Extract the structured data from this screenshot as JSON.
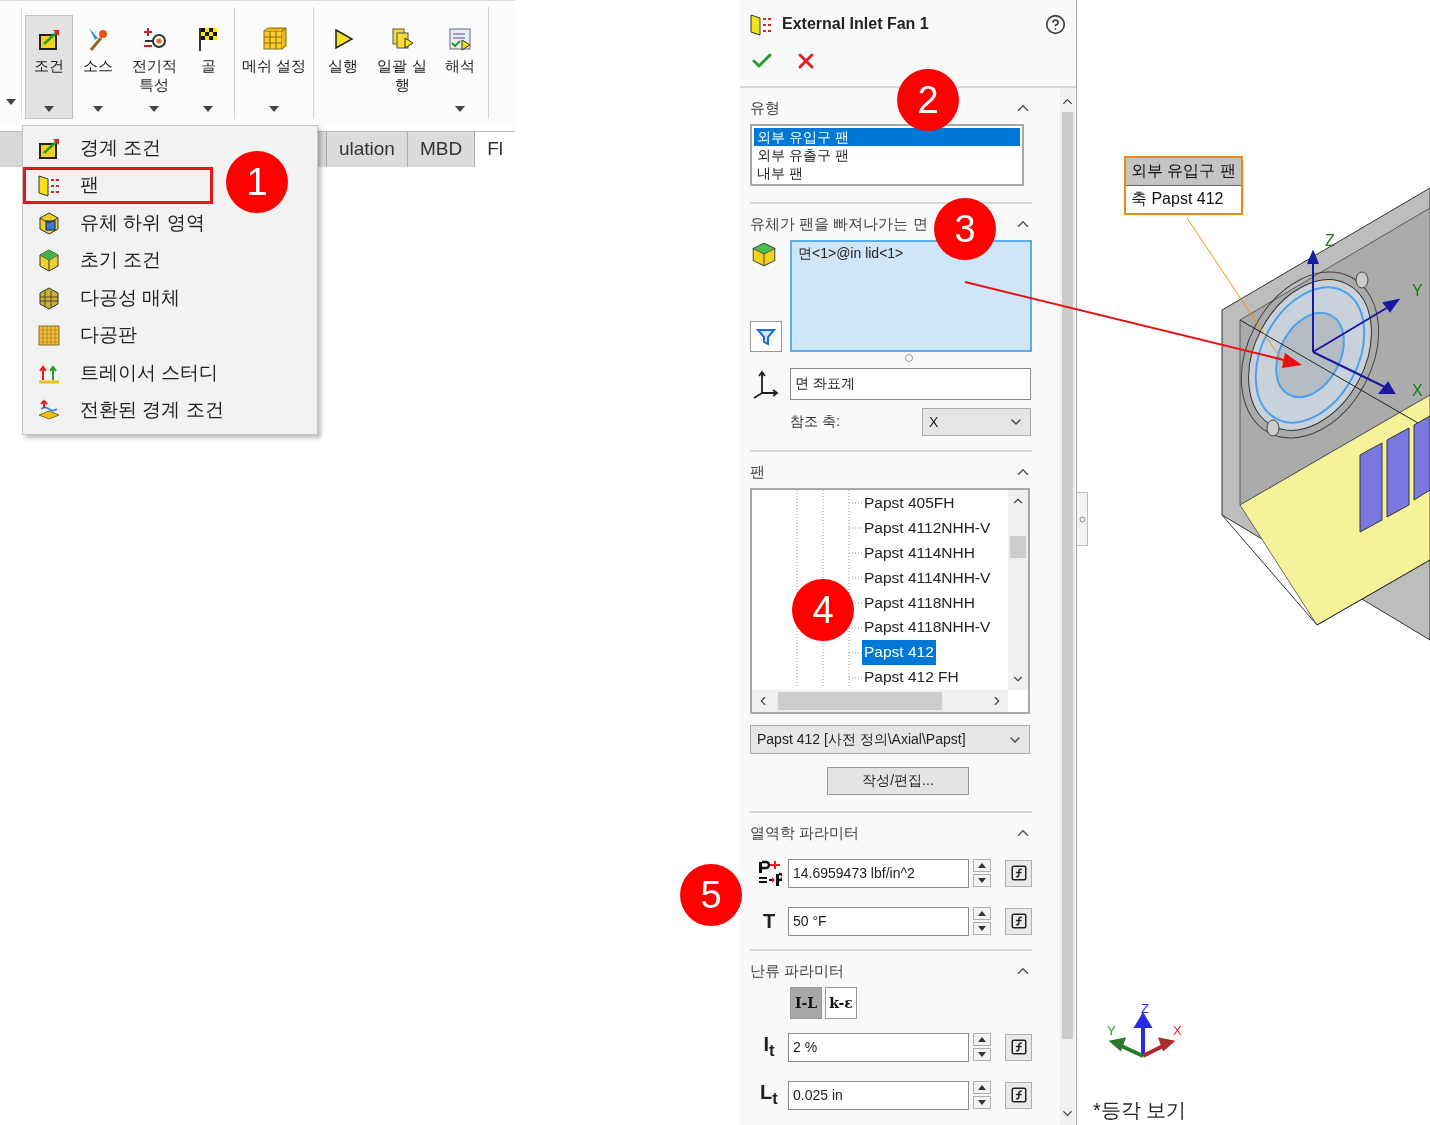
{
  "ribbon": {
    "groups": [
      {
        "buttons": [
          {
            "label": "조건",
            "selected": true,
            "dropdown": true
          },
          {
            "label": "소스",
            "selected": false,
            "dropdown": true
          },
          {
            "label": "전기적 특성",
            "selected": false,
            "dropdown": true
          },
          {
            "label": "골",
            "selected": false,
            "dropdown": true
          }
        ]
      },
      {
        "buttons": [
          {
            "label": "메쉬 설정",
            "selected": false,
            "dropdown": true
          }
        ]
      },
      {
        "buttons": [
          {
            "label": "실행",
            "selected": false,
            "dropdown": false
          },
          {
            "label": "일괄 실행",
            "selected": false,
            "dropdown": false
          },
          {
            "label": "해석",
            "selected": false,
            "dropdown": true
          }
        ]
      }
    ],
    "tabs": [
      {
        "label": "ulation",
        "selected": false
      },
      {
        "label": "MBD",
        "selected": false
      },
      {
        "label": "Fl",
        "selected": true
      }
    ]
  },
  "menu": {
    "items": [
      {
        "label": "경계 조건",
        "highlighted": false
      },
      {
        "label": "팬",
        "highlighted": true
      },
      {
        "label": "유체 하위 영역",
        "highlighted": false
      },
      {
        "label": "초기 조건",
        "highlighted": false
      },
      {
        "label": "다공성 매체",
        "highlighted": false
      },
      {
        "label": "다공판",
        "highlighted": false
      },
      {
        "label": "트레이서 스터디",
        "highlighted": false
      },
      {
        "label": "전환된 경계 조건",
        "highlighted": false
      }
    ]
  },
  "panel": {
    "title": "External Inlet Fan 1",
    "sections": [
      {
        "kind": "list",
        "title": "유형",
        "expanded": true,
        "items": [
          {
            "label": "외부 유입구 팬",
            "selected": true
          },
          {
            "label": "외부 유출구 팬",
            "selected": false
          },
          {
            "label": "내부 팬",
            "selected": false
          }
        ]
      },
      {
        "kind": "face",
        "title": "유체가 팬을 빠져나가는 면",
        "expanded": true,
        "faces": [
          "면<1>@in lid<1>"
        ],
        "coordinate_system": "면 좌표계",
        "reference_axis_label": "참조 축:",
        "reference_axis": "X"
      },
      {
        "kind": "fan",
        "title": "팬",
        "expanded": true,
        "tree": [
          {
            "label": "Papst 405FH",
            "selected": false
          },
          {
            "label": "Papst 4112NHH-V",
            "selected": false
          },
          {
            "label": "Papst 4114NHH",
            "selected": false
          },
          {
            "label": "Papst 4114NHH-V",
            "selected": false
          },
          {
            "label": "Papst 4118NHH",
            "selected": false
          },
          {
            "label": "Papst 4118NHH-V",
            "selected": false
          },
          {
            "label": "Papst 412",
            "selected": true
          },
          {
            "label": "Papst 412 FH",
            "selected": false
          }
        ],
        "fan_value": "Papst 412 [사전 정의\\Axial\\Papst]",
        "button": "작성/편집..."
      },
      {
        "kind": "params",
        "title": "열역학 파라미터",
        "expanded": true,
        "fields": [
          {
            "kind": "pressure",
            "value": "14.6959473 lbf/in^2"
          },
          {
            "kind": "symbol",
            "symbol": "T",
            "value": "50 °F"
          }
        ]
      },
      {
        "kind": "params",
        "title": "난류 파라미터",
        "expanded": true,
        "modes": [
          {
            "label": "I-L",
            "selected": true
          },
          {
            "label": "k-ε",
            "selected": false
          }
        ],
        "fields": [
          {
            "kind": "symbol",
            "symbol": "I$_{t}$",
            "value": "2 %"
          },
          {
            "kind": "symbol",
            "symbol": "L$_{t}$",
            "value": "0.025 in"
          }
        ]
      }
    ]
  },
  "viewport": {
    "tag": {
      "title": "외부 유입구 팬",
      "text": "축 Papst 412"
    },
    "model_axes": [
      "Z",
      "Y",
      "X"
    ],
    "triad_axes": [
      "Z",
      "Y",
      "X"
    ],
    "view_name": "*등각 보기"
  },
  "callouts": [
    "1",
    "2",
    "3",
    "4",
    "5"
  ]
}
